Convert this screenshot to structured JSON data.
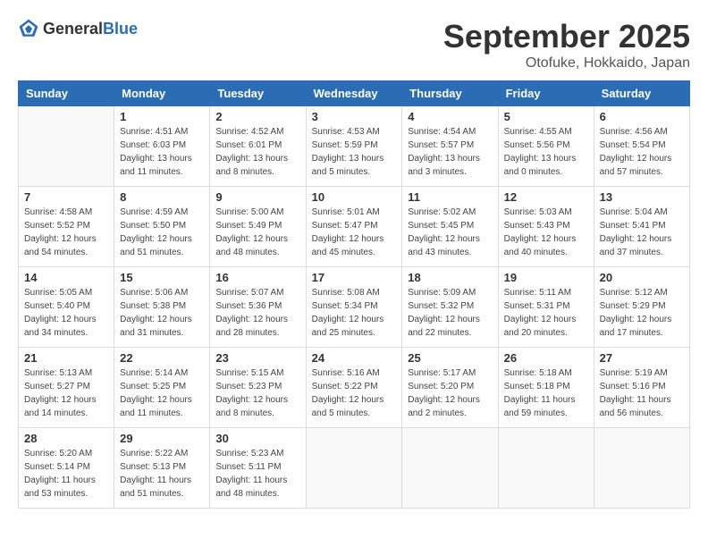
{
  "logo": {
    "general": "General",
    "blue": "Blue"
  },
  "header": {
    "month": "September 2025",
    "location": "Otofuke, Hokkaido, Japan"
  },
  "weekdays": [
    "Sunday",
    "Monday",
    "Tuesday",
    "Wednesday",
    "Thursday",
    "Friday",
    "Saturday"
  ],
  "weeks": [
    [
      {
        "day": "",
        "info": ""
      },
      {
        "day": "1",
        "info": "Sunrise: 4:51 AM\nSunset: 6:03 PM\nDaylight: 13 hours\nand 11 minutes."
      },
      {
        "day": "2",
        "info": "Sunrise: 4:52 AM\nSunset: 6:01 PM\nDaylight: 13 hours\nand 8 minutes."
      },
      {
        "day": "3",
        "info": "Sunrise: 4:53 AM\nSunset: 5:59 PM\nDaylight: 13 hours\nand 5 minutes."
      },
      {
        "day": "4",
        "info": "Sunrise: 4:54 AM\nSunset: 5:57 PM\nDaylight: 13 hours\nand 3 minutes."
      },
      {
        "day": "5",
        "info": "Sunrise: 4:55 AM\nSunset: 5:56 PM\nDaylight: 13 hours\nand 0 minutes."
      },
      {
        "day": "6",
        "info": "Sunrise: 4:56 AM\nSunset: 5:54 PM\nDaylight: 12 hours\nand 57 minutes."
      }
    ],
    [
      {
        "day": "7",
        "info": "Sunrise: 4:58 AM\nSunset: 5:52 PM\nDaylight: 12 hours\nand 54 minutes."
      },
      {
        "day": "8",
        "info": "Sunrise: 4:59 AM\nSunset: 5:50 PM\nDaylight: 12 hours\nand 51 minutes."
      },
      {
        "day": "9",
        "info": "Sunrise: 5:00 AM\nSunset: 5:49 PM\nDaylight: 12 hours\nand 48 minutes."
      },
      {
        "day": "10",
        "info": "Sunrise: 5:01 AM\nSunset: 5:47 PM\nDaylight: 12 hours\nand 45 minutes."
      },
      {
        "day": "11",
        "info": "Sunrise: 5:02 AM\nSunset: 5:45 PM\nDaylight: 12 hours\nand 43 minutes."
      },
      {
        "day": "12",
        "info": "Sunrise: 5:03 AM\nSunset: 5:43 PM\nDaylight: 12 hours\nand 40 minutes."
      },
      {
        "day": "13",
        "info": "Sunrise: 5:04 AM\nSunset: 5:41 PM\nDaylight: 12 hours\nand 37 minutes."
      }
    ],
    [
      {
        "day": "14",
        "info": "Sunrise: 5:05 AM\nSunset: 5:40 PM\nDaylight: 12 hours\nand 34 minutes."
      },
      {
        "day": "15",
        "info": "Sunrise: 5:06 AM\nSunset: 5:38 PM\nDaylight: 12 hours\nand 31 minutes."
      },
      {
        "day": "16",
        "info": "Sunrise: 5:07 AM\nSunset: 5:36 PM\nDaylight: 12 hours\nand 28 minutes."
      },
      {
        "day": "17",
        "info": "Sunrise: 5:08 AM\nSunset: 5:34 PM\nDaylight: 12 hours\nand 25 minutes."
      },
      {
        "day": "18",
        "info": "Sunrise: 5:09 AM\nSunset: 5:32 PM\nDaylight: 12 hours\nand 22 minutes."
      },
      {
        "day": "19",
        "info": "Sunrise: 5:11 AM\nSunset: 5:31 PM\nDaylight: 12 hours\nand 20 minutes."
      },
      {
        "day": "20",
        "info": "Sunrise: 5:12 AM\nSunset: 5:29 PM\nDaylight: 12 hours\nand 17 minutes."
      }
    ],
    [
      {
        "day": "21",
        "info": "Sunrise: 5:13 AM\nSunset: 5:27 PM\nDaylight: 12 hours\nand 14 minutes."
      },
      {
        "day": "22",
        "info": "Sunrise: 5:14 AM\nSunset: 5:25 PM\nDaylight: 12 hours\nand 11 minutes."
      },
      {
        "day": "23",
        "info": "Sunrise: 5:15 AM\nSunset: 5:23 PM\nDaylight: 12 hours\nand 8 minutes."
      },
      {
        "day": "24",
        "info": "Sunrise: 5:16 AM\nSunset: 5:22 PM\nDaylight: 12 hours\nand 5 minutes."
      },
      {
        "day": "25",
        "info": "Sunrise: 5:17 AM\nSunset: 5:20 PM\nDaylight: 12 hours\nand 2 minutes."
      },
      {
        "day": "26",
        "info": "Sunrise: 5:18 AM\nSunset: 5:18 PM\nDaylight: 11 hours\nand 59 minutes."
      },
      {
        "day": "27",
        "info": "Sunrise: 5:19 AM\nSunset: 5:16 PM\nDaylight: 11 hours\nand 56 minutes."
      }
    ],
    [
      {
        "day": "28",
        "info": "Sunrise: 5:20 AM\nSunset: 5:14 PM\nDaylight: 11 hours\nand 53 minutes."
      },
      {
        "day": "29",
        "info": "Sunrise: 5:22 AM\nSunset: 5:13 PM\nDaylight: 11 hours\nand 51 minutes."
      },
      {
        "day": "30",
        "info": "Sunrise: 5:23 AM\nSunset: 5:11 PM\nDaylight: 11 hours\nand 48 minutes."
      },
      {
        "day": "",
        "info": ""
      },
      {
        "day": "",
        "info": ""
      },
      {
        "day": "",
        "info": ""
      },
      {
        "day": "",
        "info": ""
      }
    ]
  ]
}
